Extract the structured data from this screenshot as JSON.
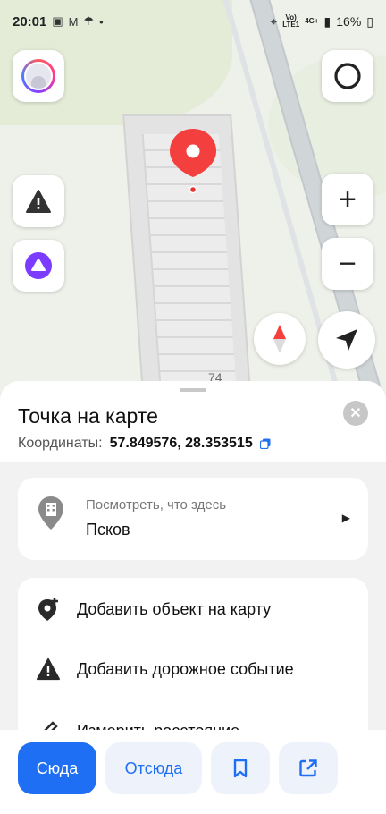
{
  "status_bar": {
    "time": "20:01",
    "network_top": "Vo)",
    "network_bottom": "LTE1",
    "net_4g": "4G+",
    "battery": "16%"
  },
  "map": {
    "house_number": "74"
  },
  "sheet": {
    "title": "Точка на карте",
    "coords_label": "Координаты:",
    "coords_value": "57.849576, 28.353515"
  },
  "whats_here": {
    "label": "Посмотреть, что здесь",
    "city": "Псков"
  },
  "actions": [
    {
      "label": "Добавить объект на карту",
      "icon": "add-place-icon"
    },
    {
      "label": "Добавить дорожное событие",
      "icon": "warning-icon"
    },
    {
      "label": "Измерить расстояние",
      "icon": "ruler-icon"
    }
  ],
  "toolbar": {
    "to_here": "Сюда",
    "from_here": "Отсюда"
  },
  "colors": {
    "accent": "#1f6ff5",
    "pin": "#f43f3f",
    "alice": "#7b3cff"
  }
}
